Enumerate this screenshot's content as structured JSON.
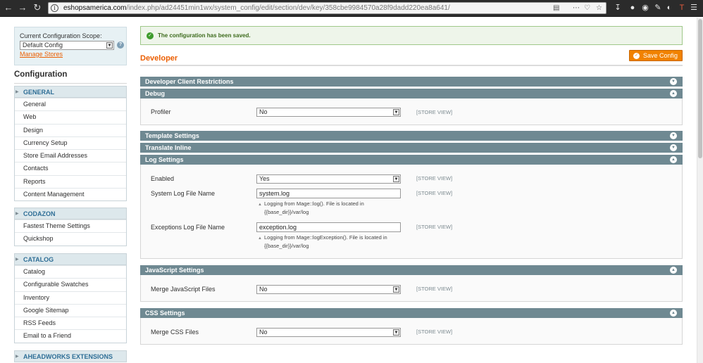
{
  "browser": {
    "url_host": "eshopsamerica.com",
    "url_path": "/index.php/ad24451min1wx/system_config/edit/section/dev/key/358cbe9984570a28f9dadd220ea8a641/"
  },
  "sidebar": {
    "scope_label": "Current Configuration Scope:",
    "scope_value": "Default Config",
    "manage_stores": "Manage Stores",
    "config_title": "Configuration",
    "groups": [
      {
        "title": "GENERAL",
        "items": [
          "General",
          "Web",
          "Design",
          "Currency Setup",
          "Store Email Addresses",
          "Contacts",
          "Reports",
          "Content Management"
        ]
      },
      {
        "title": "CODAZON",
        "items": [
          "Fastest Theme Settings",
          "Quickshop"
        ]
      },
      {
        "title": "CATALOG",
        "items": [
          "Catalog",
          "Configurable Swatches",
          "Inventory",
          "Google Sitemap",
          "RSS Feeds",
          "Email to a Friend"
        ]
      },
      {
        "title": "AHEADWORKS EXTENSIONS",
        "items": []
      }
    ]
  },
  "main": {
    "message": "The configuration has been saved.",
    "page_title": "Developer",
    "save_label": "Save Config",
    "scope_tag": "[STORE VIEW]",
    "sections": {
      "client_restrictions": "Developer Client Restrictions",
      "debug": "Debug",
      "template": "Template Settings",
      "translate": "Translate Inline",
      "log": "Log Settings",
      "javascript": "JavaScript Settings",
      "css": "CSS Settings"
    },
    "fields": {
      "profiler_label": "Profiler",
      "profiler_value": "No",
      "enabled_label": "Enabled",
      "enabled_value": "Yes",
      "syslog_label": "System Log File Name",
      "syslog_value": "system.log",
      "syslog_note": "Logging from Mage::log(). File is located in {{base_dir}}/var/log",
      "exlog_label": "Exceptions Log File Name",
      "exlog_value": "exception.log",
      "exlog_note": "Logging from Mage::logException(). File is located in {{base_dir}}/var/log",
      "mergejs_label": "Merge JavaScript Files",
      "mergejs_value": "No",
      "mergecss_label": "Merge CSS Files",
      "mergecss_value": "No"
    }
  }
}
